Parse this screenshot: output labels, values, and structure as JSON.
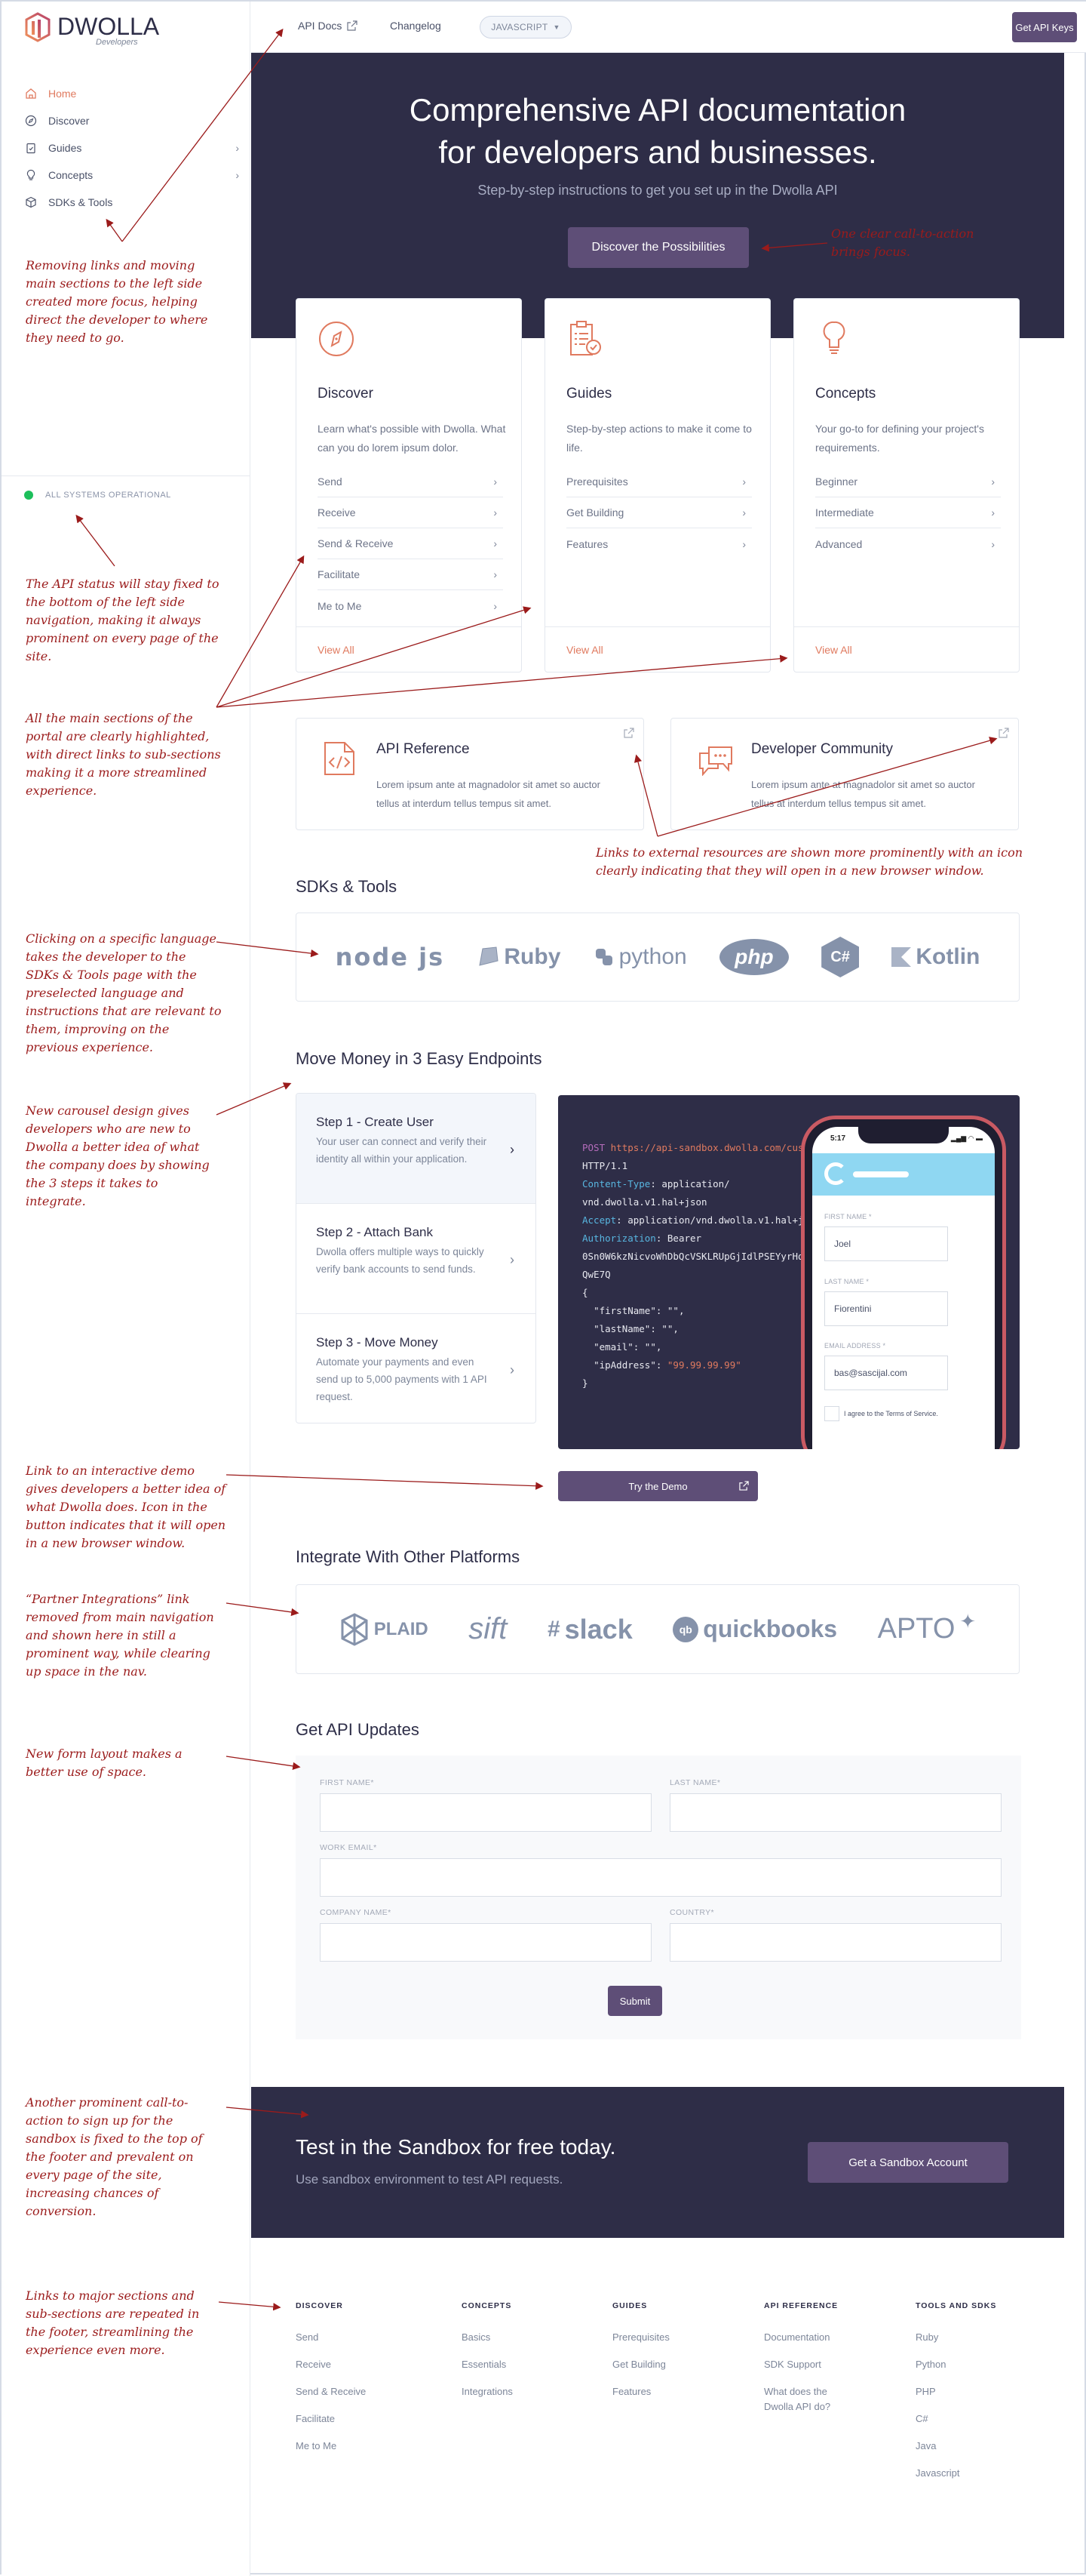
{
  "brand": {
    "name": "DWOLLA",
    "sub": "Developers",
    "accent": "#e07a5f",
    "primary": "#5e4e77",
    "dark": "#2e2d47"
  },
  "sidebar": {
    "items": [
      {
        "label": "Home",
        "icon": "home-icon",
        "active": true,
        "chevron": false
      },
      {
        "label": "Discover",
        "icon": "compass-icon",
        "active": false,
        "chevron": false
      },
      {
        "label": "Guides",
        "icon": "clipboard-icon",
        "active": false,
        "chevron": true
      },
      {
        "label": "Concepts",
        "icon": "lightbulb-icon",
        "active": false,
        "chevron": true
      },
      {
        "label": "SDKs & Tools",
        "icon": "cube-icon",
        "active": false,
        "chevron": false
      }
    ],
    "status": "ALL SYSTEMS OPERATIONAL"
  },
  "topbar": {
    "api_docs": "API Docs",
    "changelog": "Changelog",
    "language": "JAVASCRIPT",
    "get_keys": "Get API Keys"
  },
  "hero": {
    "title_line1": "Comprehensive API documentation",
    "title_line2": "for developers and businesses.",
    "subtitle": "Step-by-step instructions to get you set up in the Dwolla API",
    "cta": "Discover the Possibilities"
  },
  "sections": [
    {
      "title": "Discover",
      "desc": "Learn what's possible with Dwolla. What can you do lorem ipsum dolor.",
      "links": [
        "Send",
        "Receive",
        "Send & Receive",
        "Facilitate",
        "Me to Me"
      ],
      "view_all": "View All"
    },
    {
      "title": "Guides",
      "desc": "Step-by-step actions to make it come to life.",
      "links": [
        "Prerequisites",
        "Get Building",
        "Features"
      ],
      "view_all": "View All"
    },
    {
      "title": "Concepts",
      "desc": "Your go-to for defining your project's requirements.",
      "links": [
        "Beginner",
        "Intermediate",
        "Advanced"
      ],
      "view_all": "View All"
    }
  ],
  "external": [
    {
      "title": "API Reference",
      "desc": "Lorem ipsum ante at magnadolor sit amet so auctor tellus at interdum tellus tempus sit amet."
    },
    {
      "title": "Developer Community",
      "desc": "Lorem ipsum ante at magnadolor sit amet so auctor tellus at interdum tellus tempus sit amet."
    }
  ],
  "sdks": {
    "title": "SDKs & Tools",
    "logos": [
      "node js",
      "Ruby",
      "python",
      "php",
      "C#",
      "Kotlin"
    ]
  },
  "steps": {
    "title": "Move Money in 3 Easy Endpoints",
    "items": [
      {
        "title": "Step 1 - Create User",
        "desc": "Your user can connect and verify their identity all within your application.",
        "active": true
      },
      {
        "title": "Step 2 - Attach Bank",
        "desc": "Dwolla offers multiple ways to quickly verify bank accounts to send funds.",
        "active": false
      },
      {
        "title": "Step 3 - Move Money",
        "desc": "Automate your payments and even send up to 5,000 payments with 1 API request.",
        "active": false
      }
    ],
    "code": {
      "method": "POST",
      "url": "https://api-sandbox.dwolla.com/customers",
      "http": "HTTP/1.1",
      "content_type_key": "Content-Type",
      "content_type_val": "application/",
      "content_type_val2": "vnd.dwolla.v1.hal+json",
      "accept_key": "Accept",
      "accept_val": "application/vnd.dwolla.v1.hal+json",
      "auth_key": "Authorization",
      "auth_val": "Bearer",
      "token1": "0Sn0W6kzNicvoWhDbQcVSKLRUpGjIdlPSEYyrHqrDDoRnQwE7Q",
      "token2": "QwE7Q",
      "open": "{",
      "line_first": "\"firstName\": \"\",",
      "line_last": "\"lastName\": \"\",",
      "line_email": "\"email\": \"\",",
      "line_ip_key": "\"ipAddress\": ",
      "line_ip_val": "\"99.99.99.99\"",
      "close": "}"
    },
    "phone": {
      "time": "5:17",
      "first_label": "FIRST NAME *",
      "first_value": "Joel",
      "last_label": "LAST NAME *",
      "last_value": "Fiorentini",
      "email_label": "EMAIL ADDRESS *",
      "email_value": "bas@sascijal.com",
      "agree": "I agree to the Terms of Service."
    },
    "demo": "Try the Demo"
  },
  "integrations": {
    "title": "Integrate With Other Platforms",
    "logos": [
      "PLAID",
      "sift",
      "slack",
      "quickbooks",
      "APTO"
    ]
  },
  "updates": {
    "title": "Get API Updates",
    "fields": {
      "first": {
        "label": "FIRST NAME*",
        "value": ""
      },
      "last": {
        "label": "LAST NAME*",
        "value": ""
      },
      "email": {
        "label": "WORK EMAIL*",
        "value": ""
      },
      "company": {
        "label": "COMPANY NAME*",
        "value": ""
      },
      "country": {
        "label": "COUNTRY*",
        "value": ""
      }
    },
    "submit": "Submit"
  },
  "sandbox": {
    "title": "Test in the Sandbox for free today.",
    "subtitle": "Use sandbox environment to test API requests.",
    "cta": "Get a Sandbox Account"
  },
  "footer": [
    {
      "heading": "DISCOVER",
      "links": [
        "Send",
        "Receive",
        "Send & Receive",
        "Facilitate",
        "Me to Me"
      ]
    },
    {
      "heading": "CONCEPTS",
      "links": [
        "Basics",
        "Essentials",
        "Integrations"
      ]
    },
    {
      "heading": "GUIDES",
      "links": [
        "Prerequisites",
        "Get Building",
        "Features"
      ]
    },
    {
      "heading": "API REFERENCE",
      "links": [
        "Documentation",
        "SDK Support",
        "What does the Dwolla API do?"
      ]
    },
    {
      "heading": "TOOLS AND SDKS",
      "links": [
        "Ruby",
        "Python",
        "PHP",
        "C#",
        "Java",
        "Javascript"
      ]
    }
  ],
  "annotations": {
    "nav": "Removing links and moving main sections to the left side created more focus, helping direct the developer to where they need to go.",
    "cta": "One clear call-to-action brings focus.",
    "status": "The API status will stay fixed to the bottom of the left side navigation, making it always prominent on every page of the site.",
    "sections": "All the main sections of the portal are clearly highlighted, with direct links to sub-sections making it a more streamlined experience.",
    "external": "Links to external resources are shown more prominently with an icon clearly indicating that they will open in a new browser window.",
    "sdks": "Clicking on a specific language takes the developer to the SDKs & Tools page with the preselected language and instructions that are relevant to them, improving on the previous experience.",
    "carousel": "New carousel design gives developers who are new to Dwolla a better idea of what the company does by showing the 3 steps it takes to integrate.",
    "demo": "Link to an interactive demo gives developers a better idea of what Dwolla does. Icon in the button indicates that it will open in a new browser window.",
    "partners": "“Partner Integrations” link removed from main navigation and shown here in still a prominent way, while clearing up space in the nav.",
    "form": "New form layout makes a better use of space.",
    "sandbox": "Another prominent call-to-action to sign up for the sandbox is fixed to the top of the footer and prevalent on every page of the site, increasing chances of conversion.",
    "footer": "Links to major sections and sub-sections are repeated in the footer, streamlining the experience even more."
  }
}
